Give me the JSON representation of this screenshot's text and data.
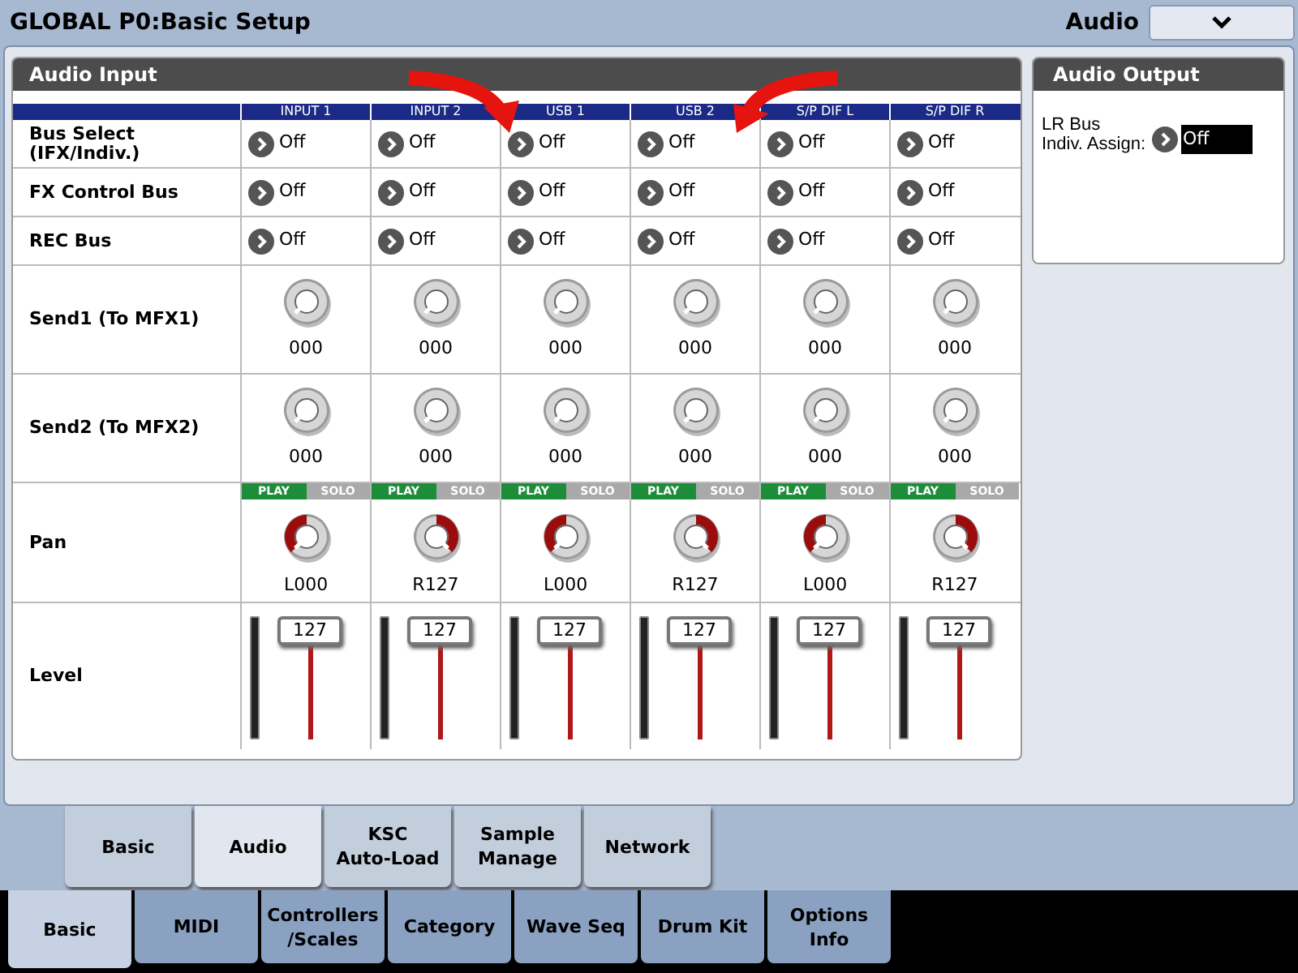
{
  "title": "GLOBAL P0:Basic Setup",
  "page_select": {
    "label": "Audio"
  },
  "audio_input": {
    "title": "Audio Input",
    "columns": [
      "INPUT 1",
      "INPUT 2",
      "USB 1",
      "USB 2",
      "S/P DIF L",
      "S/P DIF R"
    ],
    "rows": [
      {
        "kind": "select",
        "label": "Bus Select\n(IFX/Indiv.)",
        "cells": [
          {
            "value": "Off"
          },
          {
            "value": "Off"
          },
          {
            "value": "Off"
          },
          {
            "value": "Off"
          },
          {
            "value": "Off"
          },
          {
            "value": "Off"
          }
        ]
      },
      {
        "kind": "select",
        "label": "FX Control Bus",
        "cells": [
          {
            "value": "Off"
          },
          {
            "value": "Off"
          },
          {
            "value": "Off"
          },
          {
            "value": "Off"
          },
          {
            "value": "Off"
          },
          {
            "value": "Off"
          }
        ]
      },
      {
        "kind": "select",
        "label": "REC Bus",
        "cells": [
          {
            "value": "Off"
          },
          {
            "value": "Off"
          },
          {
            "value": "Off"
          },
          {
            "value": "Off"
          },
          {
            "value": "Off"
          },
          {
            "value": "Off"
          }
        ]
      },
      {
        "kind": "knob",
        "label": "Send1 (To MFX1)",
        "cells": [
          {
            "level": 0,
            "reading": "000"
          },
          {
            "level": 0,
            "reading": "000"
          },
          {
            "level": 0,
            "reading": "000"
          },
          {
            "level": 0,
            "reading": "000"
          },
          {
            "level": 0,
            "reading": "000"
          },
          {
            "level": 0,
            "reading": "000"
          }
        ]
      },
      {
        "kind": "knob",
        "label": "Send2 (To MFX2)",
        "cells": [
          {
            "level": 0,
            "reading": "000"
          },
          {
            "level": 0,
            "reading": "000"
          },
          {
            "level": 0,
            "reading": "000"
          },
          {
            "level": 0,
            "reading": "000"
          },
          {
            "level": 0,
            "reading": "000"
          },
          {
            "level": 0,
            "reading": "000"
          }
        ]
      },
      {
        "kind": "pan",
        "label": "Pan",
        "cells": [
          {
            "modes": [
              {
                "label": "PLAY",
                "selected": true
              },
              {
                "label": "SOLO",
                "selected": false
              }
            ],
            "panned_right": false,
            "reading": "L000"
          },
          {
            "modes": [
              {
                "label": "PLAY",
                "selected": true
              },
              {
                "label": "SOLO",
                "selected": false
              }
            ],
            "panned_right": true,
            "reading": "R127"
          },
          {
            "modes": [
              {
                "label": "PLAY",
                "selected": true
              },
              {
                "label": "SOLO",
                "selected": false
              }
            ],
            "panned_right": false,
            "reading": "L000"
          },
          {
            "modes": [
              {
                "label": "PLAY",
                "selected": true
              },
              {
                "label": "SOLO",
                "selected": false
              }
            ],
            "panned_right": true,
            "reading": "R127"
          },
          {
            "modes": [
              {
                "label": "PLAY",
                "selected": true
              },
              {
                "label": "SOLO",
                "selected": false
              }
            ],
            "panned_right": false,
            "reading": "L000"
          },
          {
            "modes": [
              {
                "label": "PLAY",
                "selected": true
              },
              {
                "label": "SOLO",
                "selected": false
              }
            ],
            "panned_right": true,
            "reading": "R127"
          }
        ]
      },
      {
        "kind": "fader",
        "label": "Level",
        "cells": [
          {
            "level": 1,
            "reading": "127"
          },
          {
            "level": 1,
            "reading": "127"
          },
          {
            "level": 1,
            "reading": "127"
          },
          {
            "level": 1,
            "reading": "127"
          },
          {
            "level": 1,
            "reading": "127"
          },
          {
            "level": 1,
            "reading": "127"
          }
        ]
      }
    ]
  },
  "audio_output": {
    "title": "Audio Output",
    "label": "LR Bus\nIndiv. Assign:",
    "value": "Off"
  },
  "sub_tabs": [
    {
      "label": "Basic",
      "selected": false
    },
    {
      "label": "Audio",
      "selected": true
    },
    {
      "label": "KSC\nAuto-Load",
      "selected": false
    },
    {
      "label": "Sample\nManage",
      "selected": false
    },
    {
      "label": "Network",
      "selected": false
    }
  ],
  "main_tabs": [
    {
      "label": "Basic",
      "selected": true
    },
    {
      "label": "MIDI",
      "selected": false
    },
    {
      "label": "Controllers\n/Scales",
      "selected": false
    },
    {
      "label": "Category",
      "selected": false
    },
    {
      "label": "Wave Seq",
      "selected": false
    },
    {
      "label": "Drum Kit",
      "selected": false
    },
    {
      "label": "Options\nInfo",
      "selected": false
    }
  ]
}
